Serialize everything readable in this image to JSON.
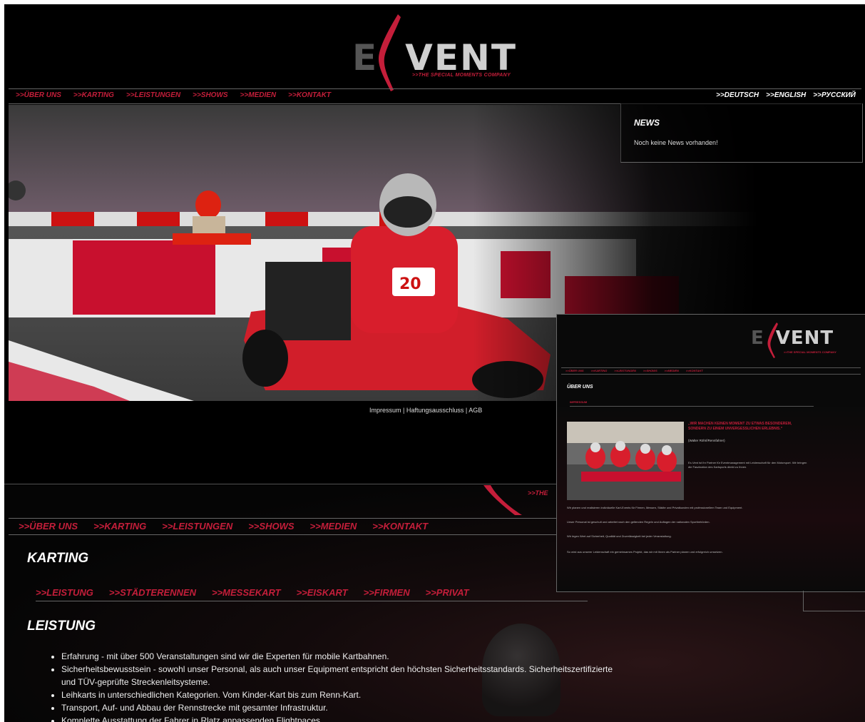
{
  "brand": {
    "logo_main": "VENT",
    "logo_dim": "E",
    "tagline": ">>THE SPECIAL MOMENTS COMPANY",
    "accent_color": "#c41e3a"
  },
  "top_nav": {
    "items": [
      ">>ÜBER UNS",
      ">>KARTING",
      ">>LEISTUNGEN",
      ">>SHOWS",
      ">>MEDIEN",
      ">>KONTAKT"
    ],
    "languages": [
      ">>DEUTSCH",
      ">>ENGLISH",
      ">>РУССКИЙ"
    ]
  },
  "hero": {
    "kart_number": "20"
  },
  "news": {
    "title": "NEWS",
    "text": "Noch keine News vorhanden!"
  },
  "footer": {
    "links": "Impressum | Haftungsausschluss | AGB"
  },
  "second_page": {
    "tagline_fragment": ">>THE",
    "nav": [
      ">>ÜBER UNS",
      ">>KARTING",
      ">>LEISTUNGEN",
      ">>SHOWS",
      ">>MEDIEN",
      ">>KONTAKT"
    ],
    "heading": "KARTING",
    "subnav": [
      ">>LEISTUNG",
      ">>STÄDTERENNEN",
      ">>MESSEKART",
      ">>EISKART",
      ">>FIRMEN",
      ">>PRIVAT"
    ],
    "subheading": "LEISTUNG",
    "bullets": [
      "Erfahrung - mit über 500 Veranstaltungen sind wir die Experten für mobile Kartbahnen.",
      "Sicherheitsbewusstsein - sowohl unser Personal, als auch unser Equipment entspricht den höchsten Sicherheitsstandards. Sicherheitszertifizierte und TÜV-geprüfte Streckenleitsysteme.",
      "Leihkarts in unterschiedlichen Kategorien. Vom Kinder-Kart bis zum Renn-Kart.",
      "Transport, Auf- und Abbau der Rennstrecke mit gesamter Infrastruktur.",
      "Komplette Ausstattung der Fahrer in Rlatz anpassenden Flightpaces"
    ]
  },
  "inset": {
    "logo_main": "VENT",
    "logo_dim": "E",
    "tagline": ">>THE SPECIAL MOMENTS COMPANY",
    "nav": [
      ">>ÜBER UNS",
      ">>KARTING",
      ">>LEISTUNGEN",
      ">>SHOWS",
      ">>MEDIEN",
      ">>KONTAKT"
    ],
    "heading": "ÜBER UNS",
    "sub": "IMPRESSUM",
    "quote": "„WIR MACHEN KEINEN MOMENT ZU ETWAS BESONDEREM, SONDERN ZU EINEM UNVERGESSLICHEN ERLEBNIS.“",
    "quote_by": "(Walter Röhrl/Rennfahrer)",
    "paragraphs": [
      "Ex-Vent ist Ihr Partner für Eventmanagement mit Leidenschaft für den Motorsport. Wir bringen die Faszination des Kartsports direkt zu Ihnen.",
      "Wir planen und realisieren individuelle Kart-Events für Firmen, Messen, Städte und Privatkunden mit professionellem Team und Equipment.",
      "Unser Personal ist geschult und arbeitet nach den geltenden Regeln und Auflagen der nationalen Sportbehörden.",
      "Wir legen Wert auf Sicherheit, Qualität und Zuverlässigkeit bei jeder Veranstaltung.",
      "So wird aus unserer Leidenschaft ein gemeinsames Projekt, das wir mit Ihnen als Partner planen und erfolgreich umsetzen."
    ]
  }
}
